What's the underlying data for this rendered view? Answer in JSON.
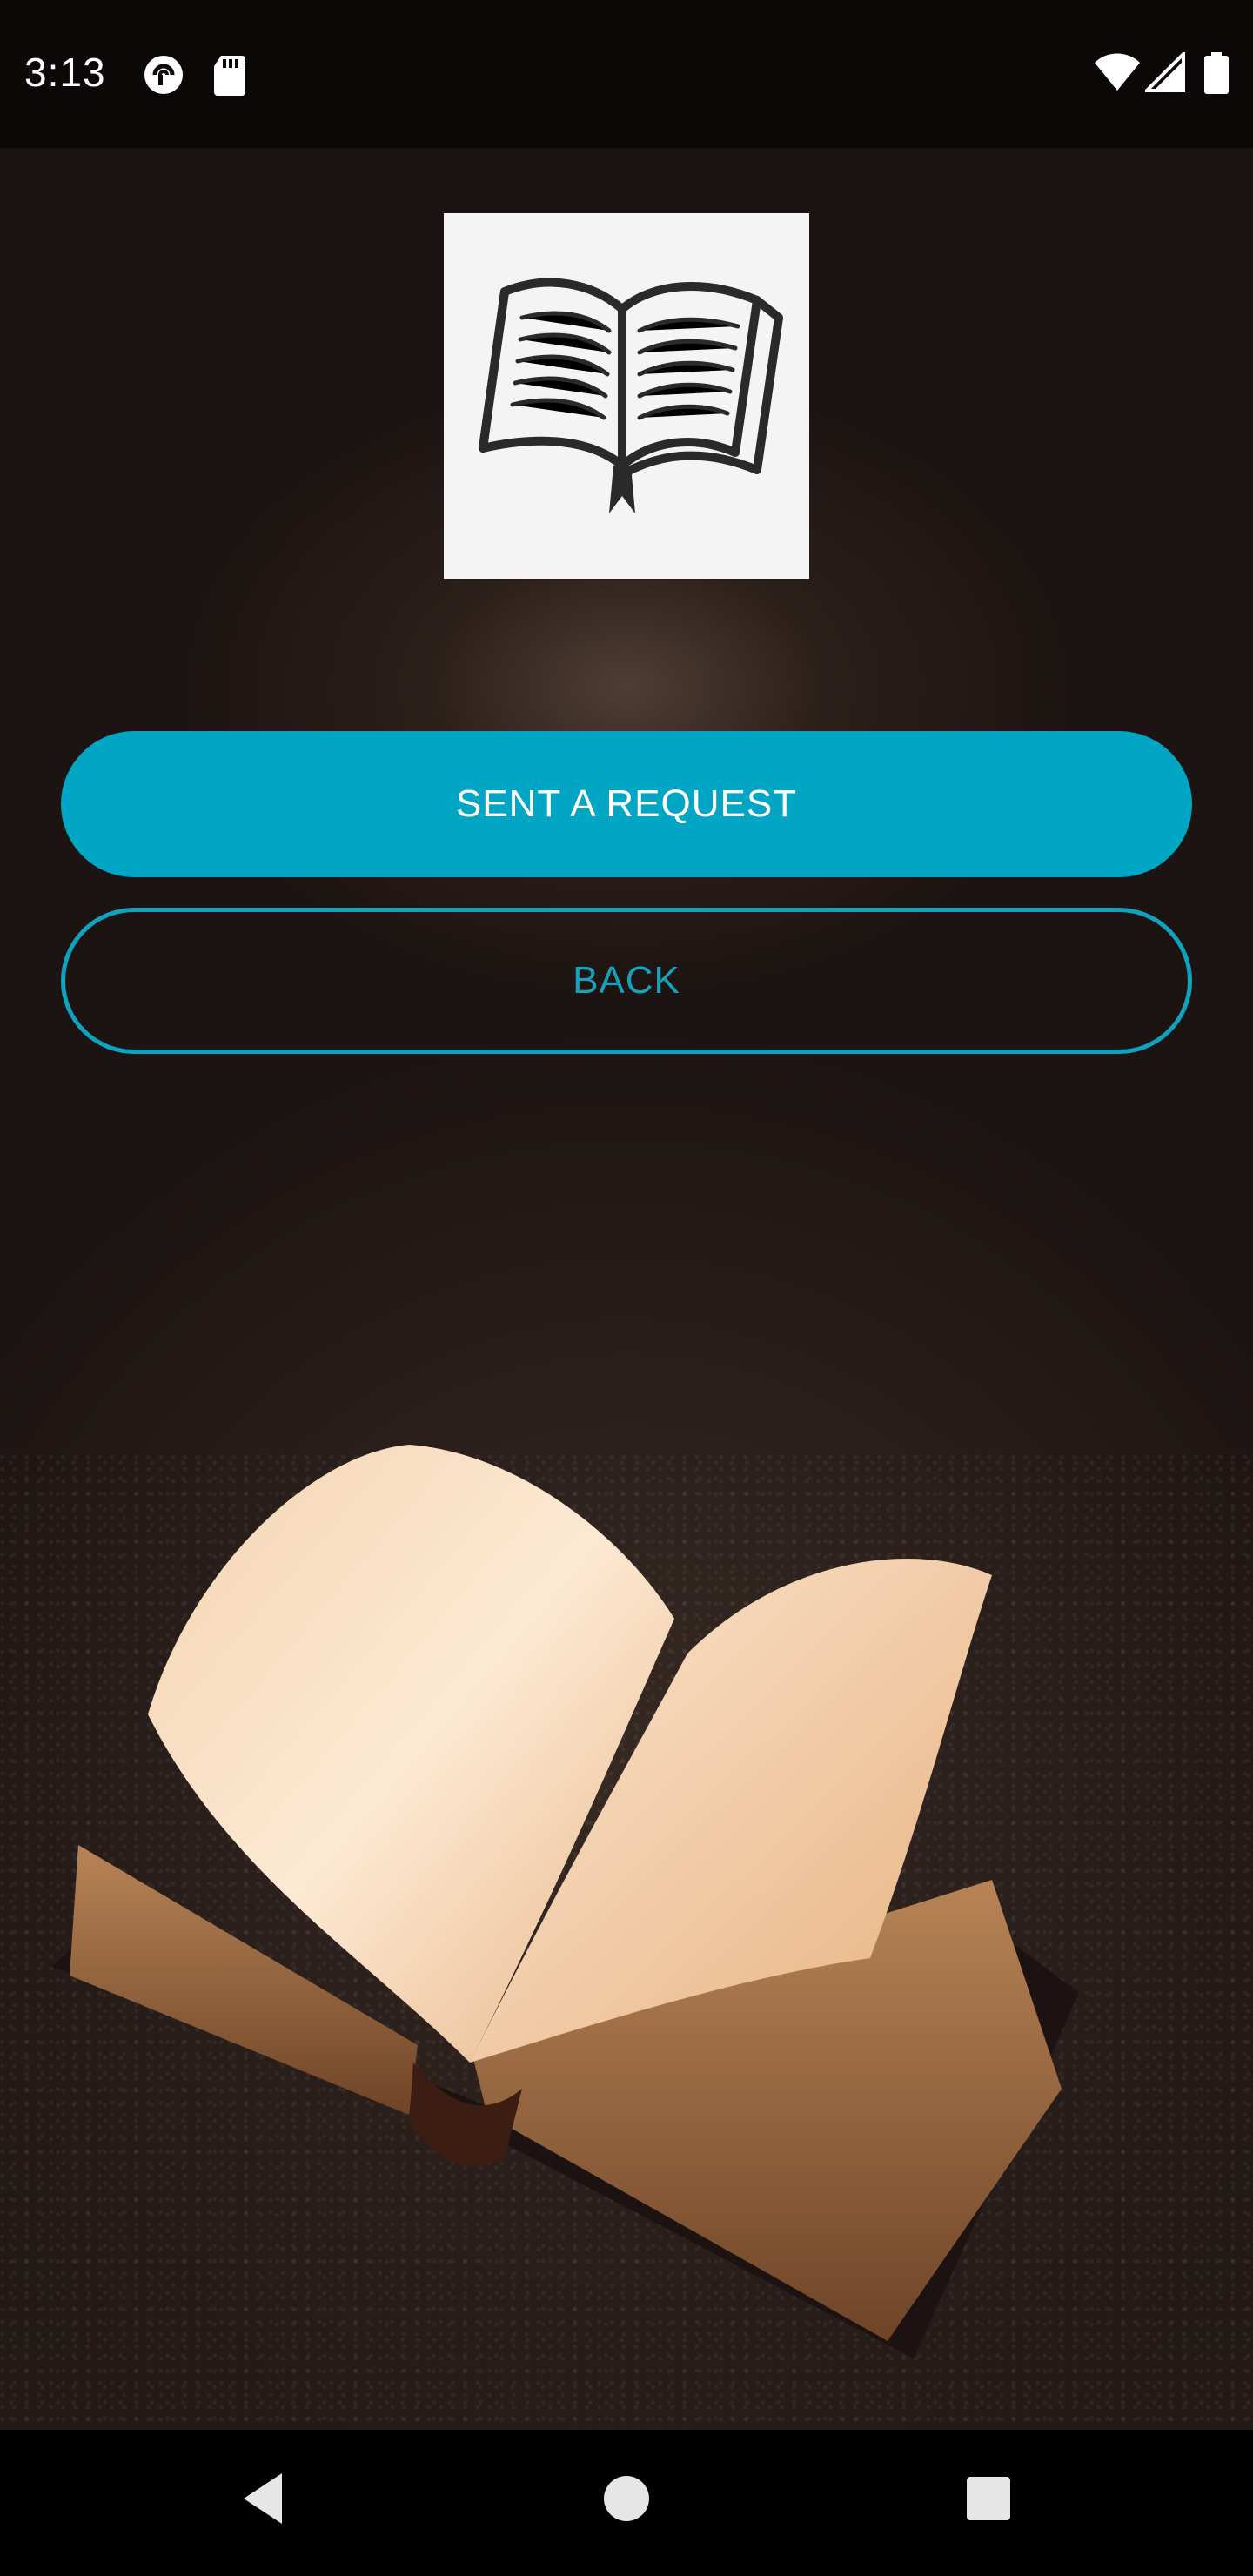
{
  "status_bar": {
    "time": "3:13",
    "left_icons": [
      "pocket-casts-icon",
      "sd-card-icon"
    ],
    "right_icons": [
      "wifi-icon",
      "signal-icon",
      "battery-icon"
    ]
  },
  "logo": {
    "icon": "open-book-sketch-icon"
  },
  "buttons": {
    "primary_label": "SENT A REQUEST",
    "secondary_label": "BACK"
  },
  "colors": {
    "accent": "#00a6c3",
    "status_bar_bg": "#0c0807",
    "nav_bar_bg": "#000000"
  },
  "background": {
    "image": "open-book-photo"
  },
  "nav_bar": {
    "buttons": [
      "back-icon",
      "home-icon",
      "recents-icon"
    ]
  }
}
